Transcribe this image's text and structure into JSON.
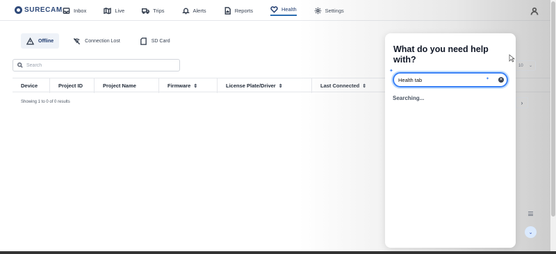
{
  "brand": {
    "name": "SURECAM"
  },
  "nav": [
    {
      "label": "Inbox",
      "icon": "inbox-icon"
    },
    {
      "label": "Live",
      "icon": "map-icon"
    },
    {
      "label": "Trips",
      "icon": "truck-icon"
    },
    {
      "label": "Alerts",
      "icon": "bell-icon"
    },
    {
      "label": "Reports",
      "icon": "report-icon"
    },
    {
      "label": "Health",
      "icon": "heart-icon",
      "active": true
    },
    {
      "label": "Settings",
      "icon": "gear-icon"
    }
  ],
  "tabs": [
    {
      "label": "Offline",
      "icon": "warning-icon",
      "active": true
    },
    {
      "label": "Connection Lost",
      "icon": "no-signal-icon"
    },
    {
      "label": "SD Card",
      "icon": "sd-card-icon"
    }
  ],
  "search": {
    "placeholder": "Search",
    "value": ""
  },
  "table": {
    "columns": [
      "Device",
      "Project ID",
      "Project Name",
      "Firmware",
      "License Plate/Driver",
      "Last Connected"
    ],
    "showing": "Showing 1 to 0 of 0 results"
  },
  "pagination": {
    "page_size": "10",
    "next": "›"
  },
  "help": {
    "title": "What do you need help with?",
    "input_value": "Health tab",
    "status": "Searching..."
  },
  "colors": {
    "accent": "#3b82f6",
    "brand": "#2f4a7a"
  }
}
